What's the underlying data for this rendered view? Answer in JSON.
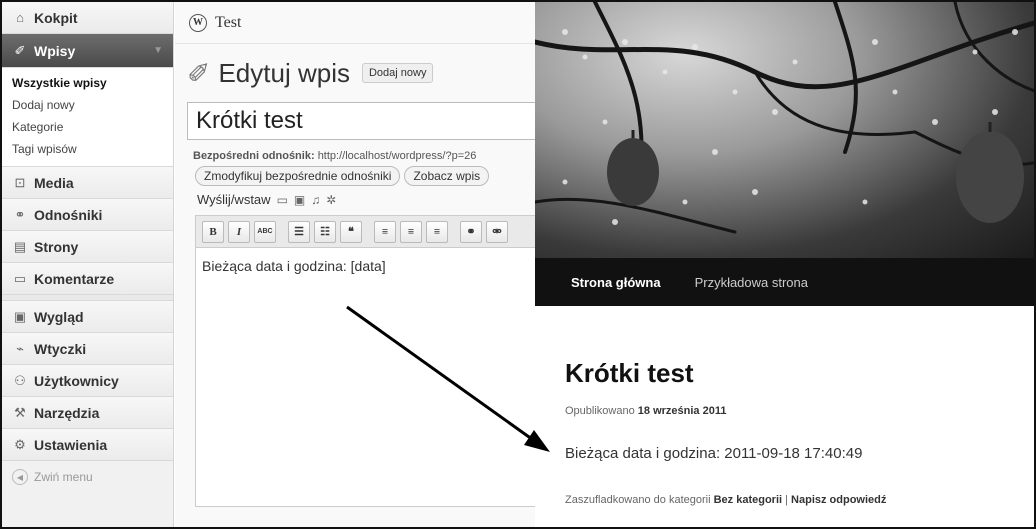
{
  "sidebar": {
    "items": [
      {
        "label": "Kokpit",
        "icon": "home-icon",
        "glyph": "⌂"
      },
      {
        "label": "Wpisy",
        "icon": "pushpin-icon",
        "glyph": "✐"
      },
      {
        "label": "Media",
        "icon": "media-icon",
        "glyph": "⊡"
      },
      {
        "label": "Odnośniki",
        "icon": "link-icon",
        "glyph": "⚭"
      },
      {
        "label": "Strony",
        "icon": "pages-icon",
        "glyph": "▤"
      },
      {
        "label": "Komentarze",
        "icon": "comment-icon",
        "glyph": "▭"
      },
      {
        "label": "Wygląd",
        "icon": "appearance-icon",
        "glyph": "▣"
      },
      {
        "label": "Wtyczki",
        "icon": "plugin-icon",
        "glyph": "⌁"
      },
      {
        "label": "Użytkownicy",
        "icon": "users-icon",
        "glyph": "⚇"
      },
      {
        "label": "Narzędzia",
        "icon": "tools-icon",
        "glyph": "⚒"
      },
      {
        "label": "Ustawienia",
        "icon": "settings-icon",
        "glyph": "⚙"
      }
    ],
    "submenu": [
      "Wszystkie wpisy",
      "Dodaj nowy",
      "Kategorie",
      "Tagi wpisów"
    ],
    "collapse": "Zwiń menu"
  },
  "editor": {
    "site_name": "Test",
    "heading": "Edytuj wpis",
    "add_new": "Dodaj nowy",
    "title_value": "Krótki test",
    "permalink_label": "Bezpośredni odnośnik:",
    "permalink_url": "http://localhost/wordpress/?p=26",
    "change_permalinks": "Zmodyfikuj bezpośrednie odnośniki",
    "view_post": "Zobacz wpis",
    "upload_label": "Wyślij/wstaw",
    "content": "Bieżąca data i godzina: [data]"
  },
  "preview": {
    "nav": [
      "Strona główna",
      "Przykładowa strona"
    ],
    "post_title": "Krótki test",
    "published_prefix": "Opublikowano",
    "published_date": "18 września 2011",
    "body": "Bieżąca data i godzina: 2011-09-18 17:40:49",
    "footer_prefix": "Zaszufladkowano do kategorii",
    "footer_category": "Bez kategorii",
    "footer_sep": "|",
    "footer_reply": "Napisz odpowiedź"
  }
}
